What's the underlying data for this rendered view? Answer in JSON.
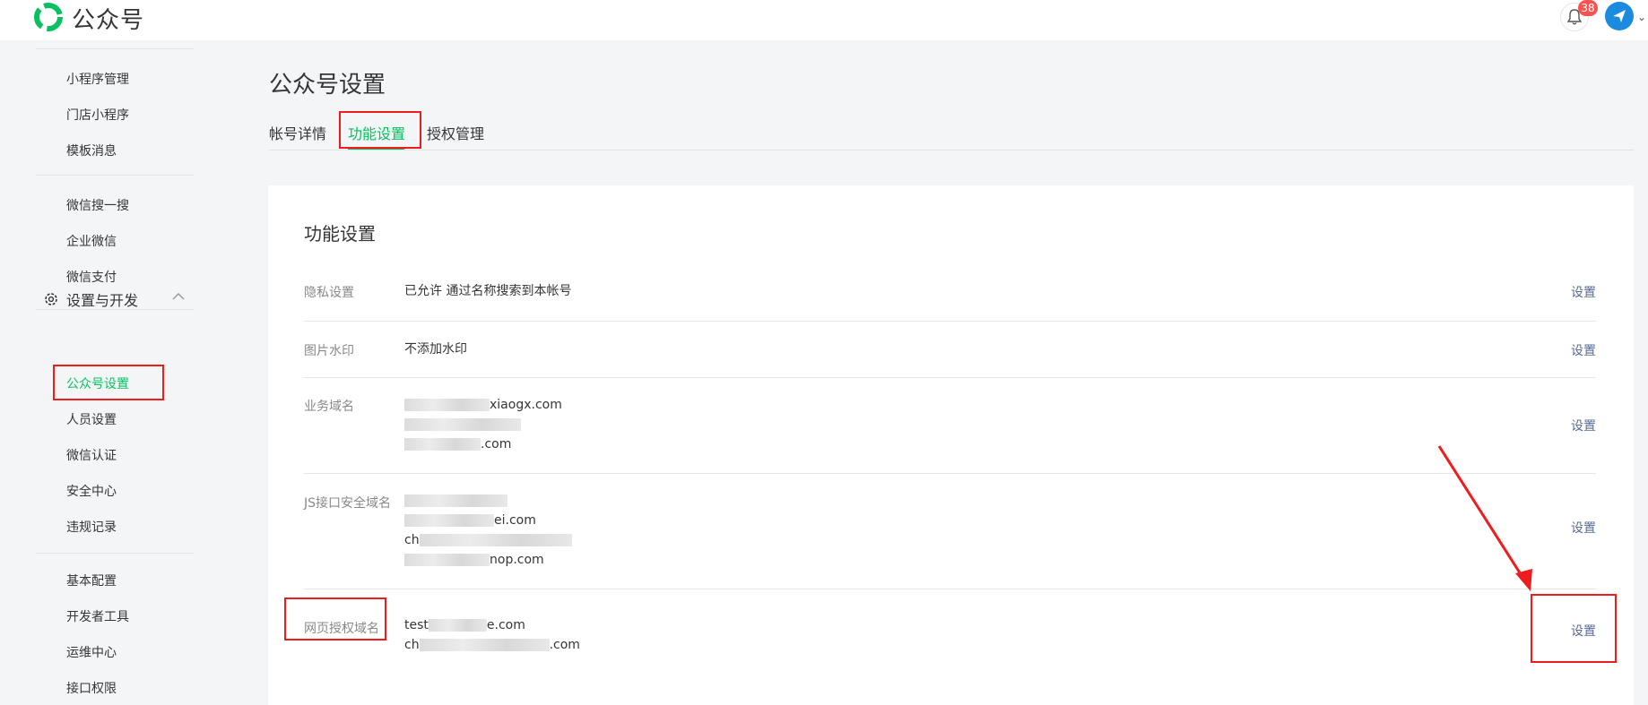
{
  "header": {
    "app_name": "公众号",
    "notification_count": "38",
    "brand_color": "#07c160",
    "icons": [
      "logo-icon",
      "bell-icon",
      "avatar-icon",
      "chevron-down-icon"
    ]
  },
  "sidebar": {
    "items_top": [
      "小程序管理",
      "门店小程序",
      "模板消息"
    ],
    "items_mid": [
      "微信搜一搜",
      "企业微信",
      "微信支付"
    ],
    "group_label": "设置与开发",
    "group_items": [
      "公众号设置",
      "人员设置",
      "微信认证",
      "安全中心",
      "违规记录"
    ],
    "items_bottom": [
      "基本配置",
      "开发者工具",
      "运维中心",
      "接口权限"
    ]
  },
  "main": {
    "title": "公众号设置",
    "tabs": [
      "帐号详情",
      "功能设置",
      "授权管理"
    ],
    "active_tab": "功能设置",
    "section_title": "功能设置",
    "rows": [
      {
        "label": "隐私设置",
        "values": [
          "已允许 通过名称搜索到本帐号"
        ],
        "action": "设置"
      },
      {
        "label": "图片水印",
        "values": [
          "不添加水印"
        ],
        "action": "设置"
      },
      {
        "label": "业务域名",
        "values": [
          "xiaogx.com",
          "",
          ".com"
        ],
        "action": "设置"
      },
      {
        "label": "JS接口安全域名",
        "values": [
          "",
          "ei.com",
          "ch",
          "nop.com"
        ],
        "action": "设置"
      },
      {
        "label": "网页授权域名",
        "values": [
          "test",
          "e.com",
          "ch",
          ".com"
        ],
        "action": "设置"
      }
    ]
  }
}
